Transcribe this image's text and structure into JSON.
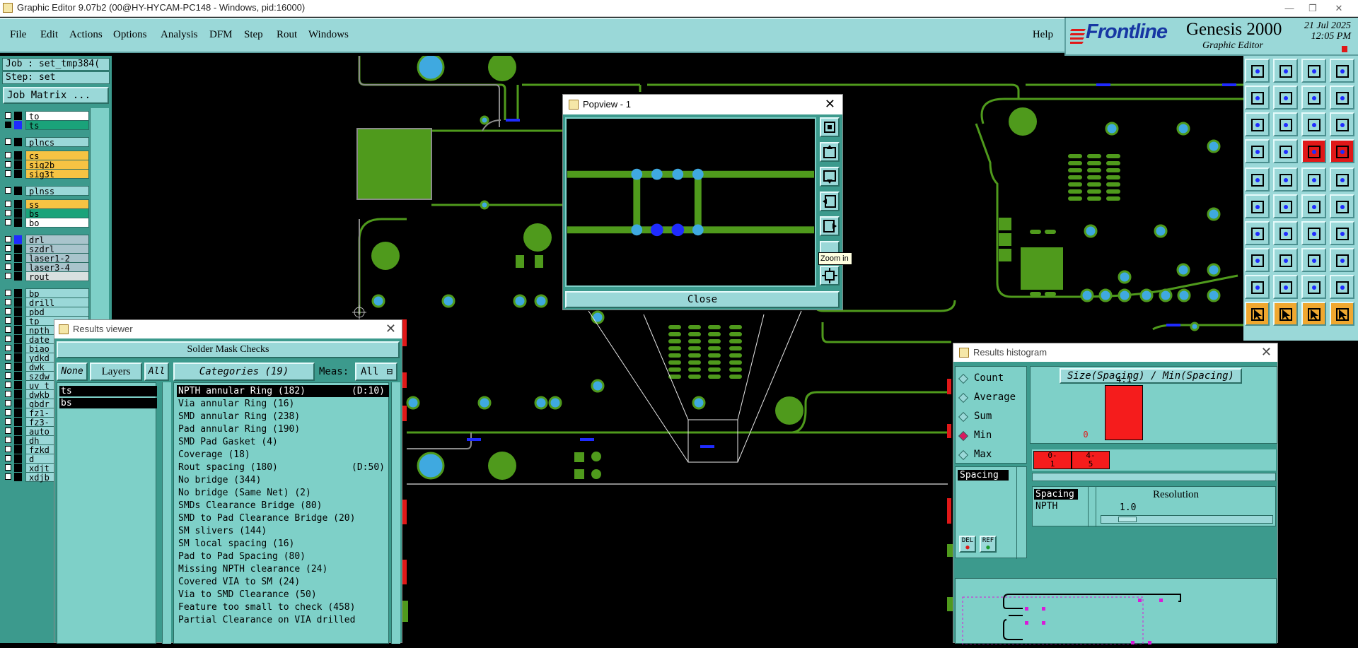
{
  "window": {
    "title": "Graphic Editor 9.07b2 (00@HY-HYCAM-PC148 - Windows, pid:16000)",
    "controls": [
      "—",
      "❐",
      "✕"
    ]
  },
  "menu": {
    "items": [
      "File",
      "Edit",
      "Actions",
      "Options",
      "Analysis",
      "DFM",
      "Step",
      "Rout",
      "Windows"
    ],
    "help": "Help"
  },
  "brand": {
    "logo": "Frontline",
    "product": "Genesis 2000",
    "subtitle": "Graphic Editor",
    "date": "21 Jul 2025",
    "time": "12:05 PM"
  },
  "job": {
    "job_line": "Job : set_tmp384(",
    "step_line": "Step: set",
    "matrix_button": "Job Matrix ..."
  },
  "layers": [
    {
      "name": "to",
      "color": "#ffffff",
      "swatch": "#000000",
      "checked": false
    },
    {
      "name": "ts",
      "color": "#1aa37a",
      "swatch": "#1f2bff",
      "checked": true
    },
    {
      "name": "plncs",
      "color": "#9ad8d8",
      "swatch": "#000000",
      "checked": false
    },
    {
      "name": "cs",
      "color": "#f6c343",
      "swatch": "#000000",
      "checked": false
    },
    {
      "name": "sig2b",
      "color": "#f6c343",
      "swatch": "#000000",
      "checked": false
    },
    {
      "name": "sig3t",
      "color": "#f6c343",
      "swatch": "#000000",
      "checked": false
    },
    {
      "name": "plnss",
      "color": "#9ad8d8",
      "swatch": "#000000",
      "checked": false
    },
    {
      "name": "ss",
      "color": "#f6c343",
      "swatch": "#000000",
      "checked": false
    },
    {
      "name": "bs",
      "color": "#1aa37a",
      "swatch": "#000000",
      "checked": false
    },
    {
      "name": "bo",
      "color": "#ffffff",
      "swatch": "#000000",
      "checked": false
    },
    {
      "name": "drl",
      "color": "#a9c4cc",
      "swatch": "#1f2bff",
      "checked": false
    },
    {
      "name": "szdrl",
      "color": "#a9c4cc",
      "swatch": "#000000",
      "checked": false
    },
    {
      "name": "laser1-2",
      "color": "#a9c4cc",
      "swatch": "#000000",
      "checked": false
    },
    {
      "name": "laser3-4",
      "color": "#a9c4cc",
      "swatch": "#000000",
      "checked": false
    },
    {
      "name": "rout",
      "color": "#d8e0e0",
      "swatch": "#000000",
      "checked": false
    },
    {
      "name": "bp",
      "color": "#9ad8d8",
      "swatch": "#000000",
      "checked": false
    },
    {
      "name": "drill",
      "color": "#9ad8d8",
      "swatch": "#000000",
      "checked": false
    },
    {
      "name": "pbd",
      "color": "#9ad8d8",
      "swatch": "#000000",
      "checked": false
    },
    {
      "name": "tp",
      "color": "#9ad8d8",
      "swatch": "#000000",
      "checked": false
    },
    {
      "name": "npth",
      "color": "#9ad8d8",
      "swatch": "#000000",
      "checked": false
    },
    {
      "name": "date",
      "color": "#9ad8d8",
      "swatch": "#000000",
      "checked": false
    },
    {
      "name": "biao",
      "color": "#9ad8d8",
      "swatch": "#000000",
      "checked": false
    },
    {
      "name": "ydkd",
      "color": "#9ad8d8",
      "swatch": "#000000",
      "checked": false
    },
    {
      "name": "dwk",
      "color": "#9ad8d8",
      "swatch": "#000000",
      "checked": false
    },
    {
      "name": "szdw",
      "color": "#9ad8d8",
      "swatch": "#000000",
      "checked": false
    },
    {
      "name": "uv_t",
      "color": "#9ad8d8",
      "swatch": "#000000",
      "checked": false
    },
    {
      "name": "dwkb",
      "color": "#9ad8d8",
      "swatch": "#000000",
      "checked": false
    },
    {
      "name": "gbdr",
      "color": "#9ad8d8",
      "swatch": "#000000",
      "checked": false
    },
    {
      "name": "fz1-",
      "color": "#9ad8d8",
      "swatch": "#000000",
      "checked": false
    },
    {
      "name": "fz3-",
      "color": "#9ad8d8",
      "swatch": "#000000",
      "checked": false
    },
    {
      "name": "auto",
      "color": "#9ad8d8",
      "swatch": "#000000",
      "checked": false
    },
    {
      "name": "dh",
      "color": "#9ad8d8",
      "swatch": "#000000",
      "checked": false
    },
    {
      "name": "fzkd",
      "color": "#9ad8d8",
      "swatch": "#000000",
      "checked": false
    },
    {
      "name": "d",
      "color": "#9ad8d8",
      "swatch": "#000000",
      "checked": false
    },
    {
      "name": "xdjt",
      "color": "#9ad8d8",
      "swatch": "#000000",
      "checked": false
    },
    {
      "name": "xdjb",
      "color": "#9ad8d8",
      "swatch": "#000000",
      "checked": false
    }
  ],
  "popview": {
    "title": "Popview - 1",
    "close": "Close",
    "tooltip": "Zoom in"
  },
  "results_viewer": {
    "title": "Results viewer",
    "section": "Solder Mask Checks",
    "none_btn": "None",
    "layers_btn": "Layers",
    "all_btn": "All",
    "categories_btn": "Categories (19)",
    "meas_label": "Meas:",
    "meas_value": "All",
    "layers": [
      "ts",
      "bs"
    ],
    "categories": [
      {
        "label": "NPTH annular Ring (182)",
        "extra": "(D:10)"
      },
      {
        "label": "Via annular Ring (16)",
        "extra": ""
      },
      {
        "label": "SMD annular Ring (238)",
        "extra": ""
      },
      {
        "label": "Pad annular Ring (190)",
        "extra": ""
      },
      {
        "label": "SMD Pad Gasket (4)",
        "extra": ""
      },
      {
        "label": "Coverage (18)",
        "extra": ""
      },
      {
        "label": "Rout spacing (180)",
        "extra": "(D:50)"
      },
      {
        "label": "No bridge (344)",
        "extra": ""
      },
      {
        "label": "No bridge (Same Net) (2)",
        "extra": ""
      },
      {
        "label": "SMDs Clearance Bridge (80)",
        "extra": ""
      },
      {
        "label": "SMD to Pad Clearance Bridge (20)",
        "extra": ""
      },
      {
        "label": "SM slivers (144)",
        "extra": ""
      },
      {
        "label": "SM local spacing (16)",
        "extra": ""
      },
      {
        "label": "Pad to Pad Spacing (80)",
        "extra": ""
      },
      {
        "label": "Missing NPTH clearance (24)",
        "extra": ""
      },
      {
        "label": "Covered VIA to SM (24)",
        "extra": ""
      },
      {
        "label": "Via to SMD Clearance (50)",
        "extra": ""
      },
      {
        "label": "Feature too small to check (458)",
        "extra": ""
      },
      {
        "label": "Partial Clearance on VIA drilled",
        "extra": ""
      }
    ]
  },
  "histogram": {
    "title": "Results histogram",
    "modes": [
      "Count",
      "Average",
      "Sum",
      "Min",
      "Max"
    ],
    "selected_mode": "Min",
    "chart_title": "Size(Spacing) / Min(Spacing)",
    "left_list": [
      "Spacing"
    ],
    "del_btn": "DEL",
    "ref_btn": "REF",
    "spacing_label": "Spacing",
    "npth_label": "NPTH",
    "resolution_label": "Resolution",
    "resolution_value": "1.0"
  },
  "chart_data": {
    "type": "bar",
    "title": "Size(Spacing) / Min(Spacing)",
    "categories": [
      "0-\n1",
      "4-\n5"
    ],
    "values": [
      0,
      4.1
    ],
    "value_labels": [
      "0",
      "4.1"
    ],
    "ylim": [
      0,
      4.1
    ]
  },
  "colors": {
    "panel": "#3c9a8d",
    "light": "#9ad8d8",
    "copper": "#4f9a1c",
    "pad": "#3fa9e0",
    "via": "#1f2bff",
    "red": "#e01818"
  }
}
